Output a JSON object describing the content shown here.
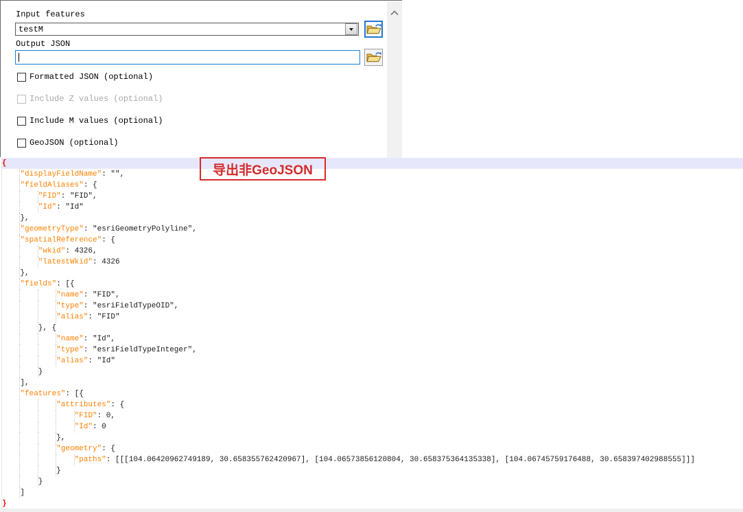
{
  "dialog": {
    "input_features": {
      "label": "Input features",
      "value": "testM"
    },
    "output_json": {
      "label": "Output JSON",
      "value": "",
      "focused": true
    },
    "checkboxes": [
      {
        "label": "Formatted JSON (optional)",
        "checked": false,
        "enabled": true
      },
      {
        "label": "Include Z values (optional)",
        "checked": false,
        "enabled": false
      },
      {
        "label": "Include M values (optional)",
        "checked": false,
        "enabled": true
      },
      {
        "label": "GeoJSON (optional)",
        "checked": false,
        "enabled": true
      }
    ],
    "icons": {
      "browse": "open-folder-with-arrow-icon",
      "combo_arrow": "dropdown-arrow-icon",
      "scroll": "chevron-up-icon"
    }
  },
  "annotation": {
    "text": "导出非GeoJSON",
    "color": "#d42a2a"
  },
  "code": {
    "active_line_index": 0,
    "colors": {
      "key": "#ff8000",
      "plain": "#1a1a1a",
      "matched_brace": "#f20000",
      "active_line_bg": "#e7e7fc"
    },
    "lines": [
      "{",
      "    \"displayFieldName\": \"\",",
      "    \"fieldAliases\": {",
      "        \"FID\": \"FID\",",
      "        \"Id\": \"Id\"",
      "    },",
      "    \"geometryType\": \"esriGeometryPolyline\",",
      "    \"spatialReference\": {",
      "        \"wkid\": 4326,",
      "        \"latestWkid\": 4326",
      "    },",
      "    \"fields\": [{",
      "            \"name\": \"FID\",",
      "            \"type\": \"esriFieldTypeOID\",",
      "            \"alias\": \"FID\"",
      "        }, {",
      "            \"name\": \"Id\",",
      "            \"type\": \"esriFieldTypeInteger\",",
      "            \"alias\": \"Id\"",
      "        }",
      "    ],",
      "    \"features\": [{",
      "            \"attributes\": {",
      "                \"FID\": 0,",
      "                \"Id\": 0",
      "            },",
      "            \"geometry\": {",
      "                \"paths\": [[[104.06420962749189, 30.658355762420967], [104.06573856120804, 30.658375364135338], [104.06745759176488, 30.658397402988555]]]",
      "            }",
      "        }",
      "    ]",
      "}"
    ]
  }
}
